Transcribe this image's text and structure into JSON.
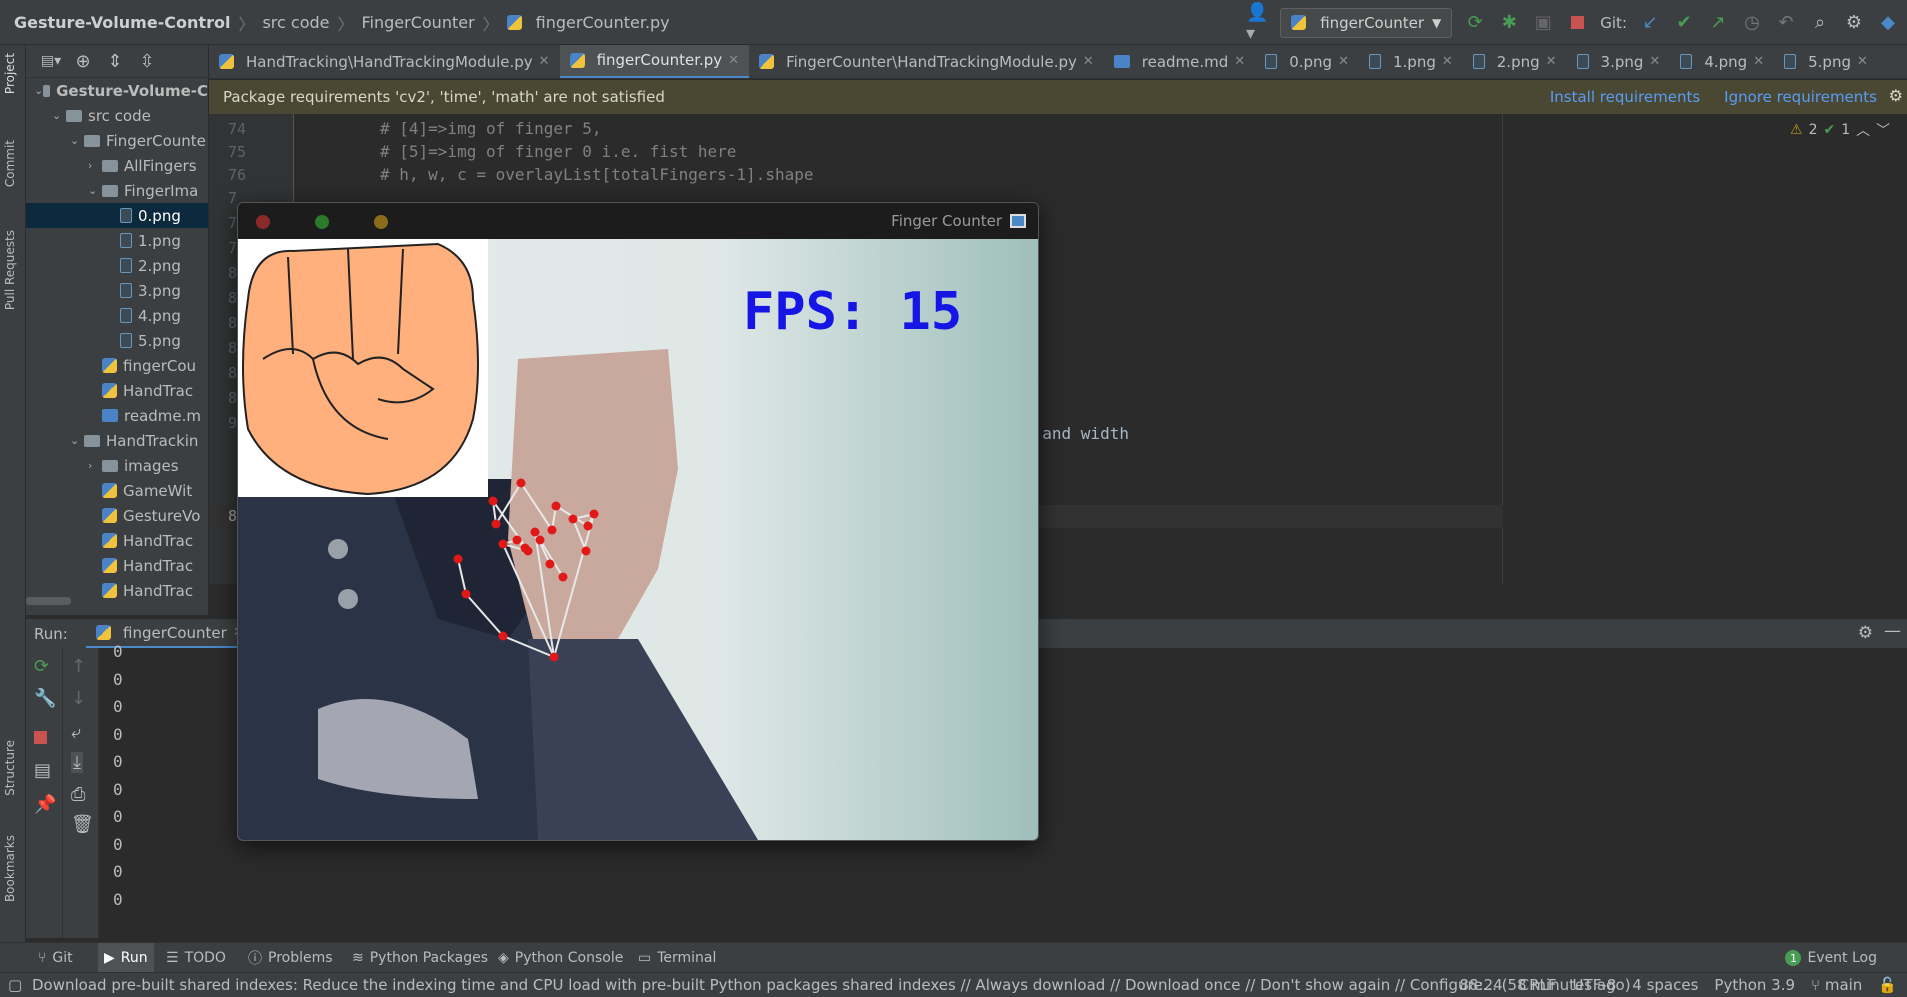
{
  "breadcrumb": {
    "project": "Gesture-Volume-Control",
    "folder1": "src code",
    "folder2": "FingerCounter",
    "file": "fingerCounter.py"
  },
  "toolbar": {
    "run_config": "fingerCounter",
    "git_label": "Git:"
  },
  "side_labels": {
    "project": "Project",
    "commit": "Commit",
    "pull_requests": "Pull Requests",
    "structure": "Structure",
    "bookmarks": "Bookmarks"
  },
  "tree": [
    {
      "label": "Gesture-Volume-C",
      "type": "folder",
      "level": 0,
      "arrow": "v"
    },
    {
      "label": "src code",
      "type": "folder",
      "level": 1,
      "arrow": "v"
    },
    {
      "label": "FingerCounte",
      "type": "folder",
      "level": 2,
      "arrow": "v"
    },
    {
      "label": "AllFingers",
      "type": "folder",
      "level": 3,
      "arrow": ">"
    },
    {
      "label": "FingerIma",
      "type": "folder",
      "level": 3,
      "arrow": "v"
    },
    {
      "label": "0.png",
      "type": "png",
      "level": 4,
      "selected": true
    },
    {
      "label": "1.png",
      "type": "png",
      "level": 4
    },
    {
      "label": "2.png",
      "type": "png",
      "level": 4
    },
    {
      "label": "3.png",
      "type": "png",
      "level": 4
    },
    {
      "label": "4.png",
      "type": "png",
      "level": 4
    },
    {
      "label": "5.png",
      "type": "png",
      "level": 4
    },
    {
      "label": "fingerCou",
      "type": "py",
      "level": 3
    },
    {
      "label": "HandTrac",
      "type": "py",
      "level": 3
    },
    {
      "label": "readme.m",
      "type": "md",
      "level": 3
    },
    {
      "label": "HandTrackin",
      "type": "folder",
      "level": 2,
      "arrow": "v"
    },
    {
      "label": "images",
      "type": "folder",
      "level": 3,
      "arrow": ">"
    },
    {
      "label": "GameWit",
      "type": "py",
      "level": 3
    },
    {
      "label": "GestureVo",
      "type": "py",
      "level": 3
    },
    {
      "label": "HandTrac",
      "type": "py",
      "level": 3
    },
    {
      "label": "HandTrac",
      "type": "py",
      "level": 3
    },
    {
      "label": "HandTrac",
      "type": "py",
      "level": 3
    }
  ],
  "tabs": [
    {
      "label": "HandTracking\\HandTrackingModule.py",
      "icon": "py"
    },
    {
      "label": "fingerCounter.py",
      "icon": "py",
      "active": true
    },
    {
      "label": "FingerCounter\\HandTrackingModule.py",
      "icon": "py"
    },
    {
      "label": "readme.md",
      "icon": "md"
    },
    {
      "label": "0.png",
      "icon": "png"
    },
    {
      "label": "1.png",
      "icon": "png"
    },
    {
      "label": "2.png",
      "icon": "png"
    },
    {
      "label": "3.png",
      "icon": "png"
    },
    {
      "label": "4.png",
      "icon": "png"
    },
    {
      "label": "5.png",
      "icon": "png"
    }
  ],
  "banner": {
    "message": "Package requirements 'cv2', 'time', 'math' are not satisfied",
    "install": "Install requirements",
    "ignore": "Ignore requirements"
  },
  "editor": {
    "lines": [
      {
        "num": "74",
        "code": "# [4]=>img of finger 5,"
      },
      {
        "num": "75",
        "code": "# [5]=>img of finger 0 i.e. fist here"
      },
      {
        "num": "76",
        "code": "# h, w, c = overlayList[totalFingers-1].shape"
      }
    ],
    "partial_code": "t and width",
    "hidden_line_digits": [
      "7",
      "7",
      "7",
      "8",
      "8",
      "8",
      "8",
      "8",
      "8",
      "9"
    ],
    "current_line_digit": "8",
    "inspection": {
      "warnings": "2",
      "ok": "1"
    }
  },
  "run": {
    "label": "Run:",
    "tab": "fingerCounter",
    "output": [
      "0",
      "0",
      "0",
      "0",
      "0",
      "0",
      "0",
      "0",
      "0",
      "0"
    ]
  },
  "popup": {
    "title": "Finger Counter",
    "fps_text": "FPS: 15"
  },
  "tool_windows": [
    {
      "label": "Git",
      "icon": "branch-icon"
    },
    {
      "label": "Run",
      "icon": "play-icon",
      "active": true
    },
    {
      "label": "TODO",
      "icon": "list-icon"
    },
    {
      "label": "Problems",
      "icon": "info-icon"
    },
    {
      "label": "Python Packages",
      "icon": "layers-icon"
    },
    {
      "label": "Python Console",
      "icon": "python-icon"
    },
    {
      "label": "Terminal",
      "icon": "terminal-icon"
    }
  ],
  "event_log": {
    "label": "Event Log",
    "count": "1"
  },
  "status": {
    "message": "Download pre-built shared indexes: Reduce the indexing time and CPU load with pre-built Python packages shared indexes // Always download // Download once // Don't show again // Configure... (58 minutes ago)",
    "position": "88:24",
    "line_sep": "CRLF",
    "encoding": "UTF-8",
    "indent": "4 spaces",
    "interpreter": "Python 3.9",
    "branch": "main"
  },
  "colors": {
    "accent": "#4a88c7",
    "fps": "#1515e6",
    "landmark": "#e11818",
    "skin": "#ffb07c"
  }
}
